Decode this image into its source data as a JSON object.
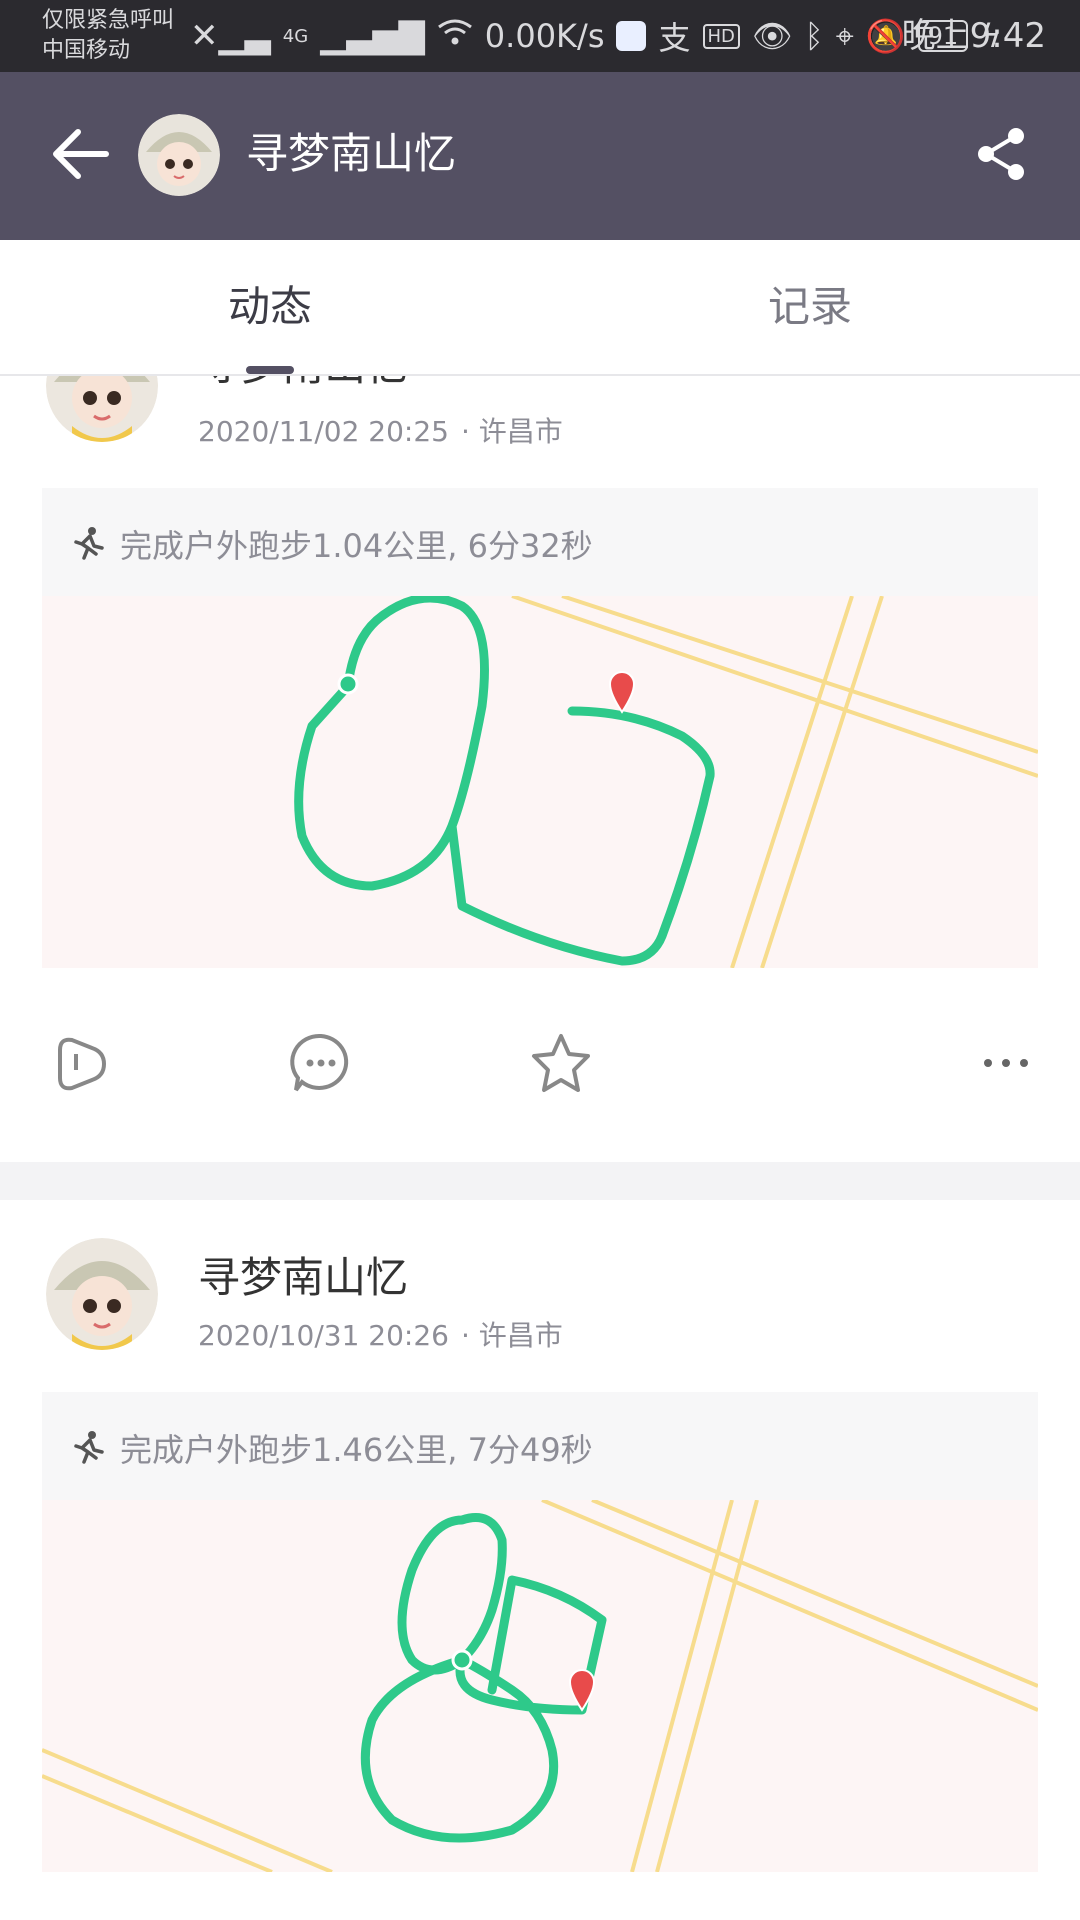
{
  "status_bar": {
    "carrier_line1": "仅限紧急呼叫",
    "carrier_line2": "中国移动",
    "network_speed": "0.00K/s",
    "network_type": "4G",
    "hd_badge": "HD",
    "battery": "91",
    "time": "晚上9:42"
  },
  "header": {
    "title": "寻梦南山忆",
    "icons": [
      "back-arrow-icon",
      "avatar",
      "share-icon"
    ]
  },
  "tabs": [
    {
      "label": "动态",
      "active": true
    },
    {
      "label": "记录",
      "active": false
    }
  ],
  "posts": [
    {
      "author": "寻梦南山忆",
      "date": "2020/11/02 20:25",
      "location": "· 许昌市",
      "activity": "完成户外跑步1.04公里, 6分32秒"
    },
    {
      "author": "寻梦南山忆",
      "date": "2020/10/31 20:26",
      "location": "· 许昌市",
      "activity": "完成户外跑步1.46公里, 7分49秒"
    }
  ],
  "colors": {
    "header_bg": "#545063",
    "status_bg": "#2b2a2f",
    "route": "#2ec98a",
    "road": "#f7dc8d",
    "map_bg": "#fdf5f5",
    "end_marker": "#e84b4b"
  }
}
